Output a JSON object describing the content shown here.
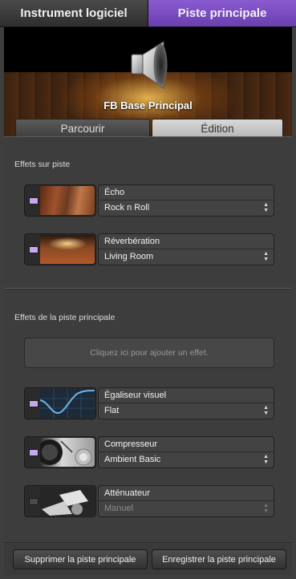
{
  "top_tabs": {
    "software_instrument": "Instrument logiciel",
    "master_track": "Piste principale"
  },
  "header": {
    "title": "FB Base Principal",
    "icon": "speaker-icon"
  },
  "sub_tabs": {
    "browse": "Parcourir",
    "edit": "Édition"
  },
  "track_effects": {
    "label": "Effets sur piste",
    "items": [
      {
        "name": "Écho",
        "preset": "Rock n Roll",
        "enabled": true,
        "thumbnail": "canyon-thumbnail"
      },
      {
        "name": "Réverbération",
        "preset": "Living Room",
        "enabled": true,
        "thumbnail": "hall-thumbnail"
      }
    ]
  },
  "master_effects": {
    "label": "Effets de la piste principale",
    "add_placeholder": "Cliquez ici pour ajouter un effet.",
    "items": [
      {
        "name": "Égaliseur visuel",
        "preset": "Flat",
        "enabled": true,
        "thumbnail": "eq-curve-thumbnail"
      },
      {
        "name": "Compresseur",
        "preset": "Ambient Basic",
        "enabled": true,
        "thumbnail": "compressor-knob-thumbnail"
      },
      {
        "name": "Atténuateur",
        "preset": "Manuel",
        "enabled": false,
        "thumbnail": "limiter-thumbnail"
      }
    ]
  },
  "buttons": {
    "delete_master": "Supprimer la piste principale",
    "save_master": "Enregistrer la piste principale"
  },
  "colors": {
    "accent_purple": "#7a4bc4",
    "led_on": "#c9a6f0"
  }
}
